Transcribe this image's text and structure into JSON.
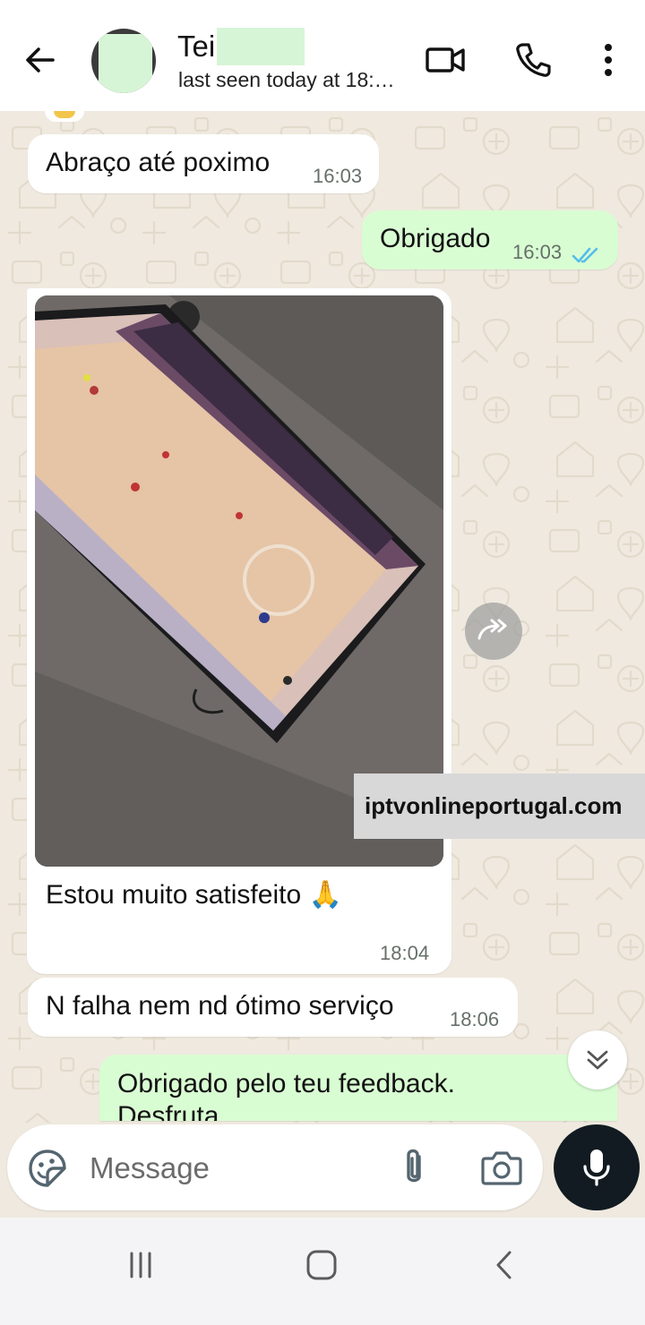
{
  "header": {
    "contact_name": "Tei",
    "last_seen": "last seen today at 18:…"
  },
  "messages": [
    {
      "direction": "in",
      "text": "Abraço até poximo",
      "time": "16:03"
    },
    {
      "direction": "out",
      "text": "Obrigado",
      "time": "16:03",
      "status": "read"
    },
    {
      "direction": "in",
      "type": "image",
      "caption": "Estou muito satisfeito 🙏",
      "time": "18:04"
    },
    {
      "direction": "in",
      "text": "N falha nem nd ótimo serviço",
      "time": "18:06"
    },
    {
      "direction": "out",
      "text": "Obrigado pelo teu feedback.",
      "text_cont": "Desfruta"
    }
  ],
  "watermark": "iptvonlineportugal.com",
  "composer": {
    "placeholder": "Message"
  },
  "icons": {
    "back": "arrow-back-icon",
    "video_call": "video-camera-icon",
    "voice_call": "phone-icon",
    "menu": "more-vertical-icon",
    "forward": "forward-icon",
    "scroll_down": "double-chevron-down-icon",
    "sticker": "sticker-icon",
    "attach": "paperclip-icon",
    "camera": "camera-icon",
    "mic": "microphone-icon",
    "recents": "recent-apps-icon",
    "home": "home-icon",
    "nav_back": "nav-back-icon"
  },
  "colors": {
    "incoming_bubble": "#ffffff",
    "outgoing_bubble": "#d9fdd3",
    "chat_background": "#efe9df",
    "read_ticks": "#53bdeb",
    "mic_button": "#111b21"
  }
}
